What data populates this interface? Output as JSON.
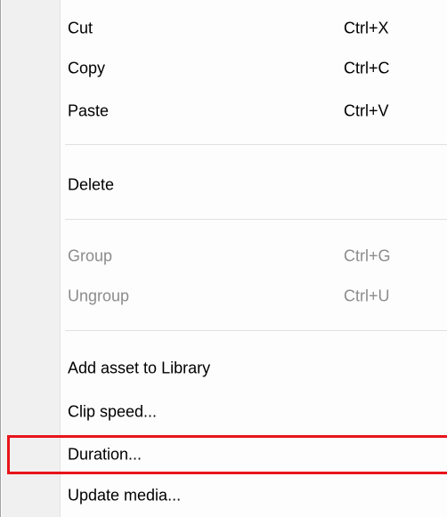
{
  "menu": {
    "items": [
      {
        "label": "Cut",
        "shortcut": "Ctrl+X"
      },
      {
        "label": "Copy",
        "shortcut": "Ctrl+C"
      },
      {
        "label": "Paste",
        "shortcut": "Ctrl+V"
      },
      {
        "label": "Delete"
      },
      {
        "label": "Group",
        "shortcut": "Ctrl+G",
        "disabled": true
      },
      {
        "label": "Ungroup",
        "shortcut": "Ctrl+U",
        "disabled": true
      },
      {
        "label": "Add asset to Library"
      },
      {
        "label": "Clip speed..."
      },
      {
        "label": "Duration...",
        "highlighted": true
      },
      {
        "label": "Update media..."
      }
    ]
  },
  "colors": {
    "text": "#000000",
    "disabled_text": "#8c8c8c",
    "highlight_outline": "#e8141b",
    "menu_background": "#fdfdfd"
  }
}
